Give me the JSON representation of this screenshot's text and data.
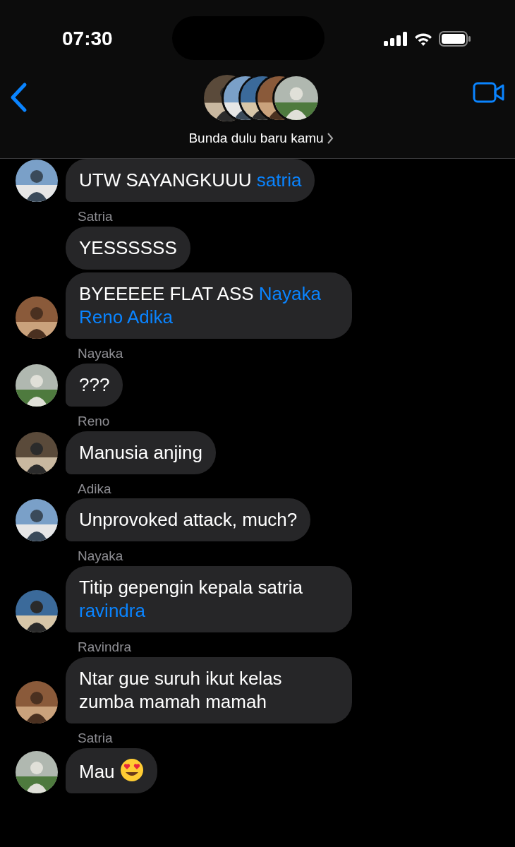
{
  "status_bar": {
    "time": "07:30"
  },
  "header": {
    "group_name": "Bunda dulu baru kamu"
  },
  "messages": [
    {
      "segments": [
        {
          "text": "UTW SAYANGKUUU ",
          "mention": false
        },
        {
          "text": "satria",
          "mention": true
        }
      ],
      "avatar": true
    },
    {
      "sender": "Satria",
      "segments": [
        {
          "text": "YESSSSSS",
          "mention": false
        }
      ],
      "avatar": false
    },
    {
      "segments": [
        {
          "text": "BYEEEEE FLAT ASS ",
          "mention": false
        },
        {
          "text": "Nayaka",
          "mention": true
        },
        {
          "text": "Reno Adika",
          "mention": true
        }
      ],
      "avatar": true
    },
    {
      "sender": "Nayaka",
      "segments": [
        {
          "text": "???",
          "mention": false
        }
      ],
      "avatar": true
    },
    {
      "sender": "Reno",
      "segments": [
        {
          "text": "Manusia anjing",
          "mention": false
        }
      ],
      "avatar": true
    },
    {
      "sender": "Adika",
      "segments": [
        {
          "text": "Unprovoked attack, much?",
          "mention": false
        }
      ],
      "avatar": true
    },
    {
      "sender": "Nayaka",
      "segments": [
        {
          "text": "Titip gepengin kepala satria ",
          "mention": false
        },
        {
          "text": "ravindra",
          "mention": true
        }
      ],
      "avatar": true
    },
    {
      "sender": "Ravindra",
      "segments": [
        {
          "text": "Ntar gue suruh ikut kelas zumba mamah mamah",
          "mention": false
        }
      ],
      "avatar": true
    },
    {
      "sender": "Satria",
      "segments": [
        {
          "text": "Mau ",
          "mention": false
        }
      ],
      "emoji": true,
      "avatar": true
    }
  ]
}
